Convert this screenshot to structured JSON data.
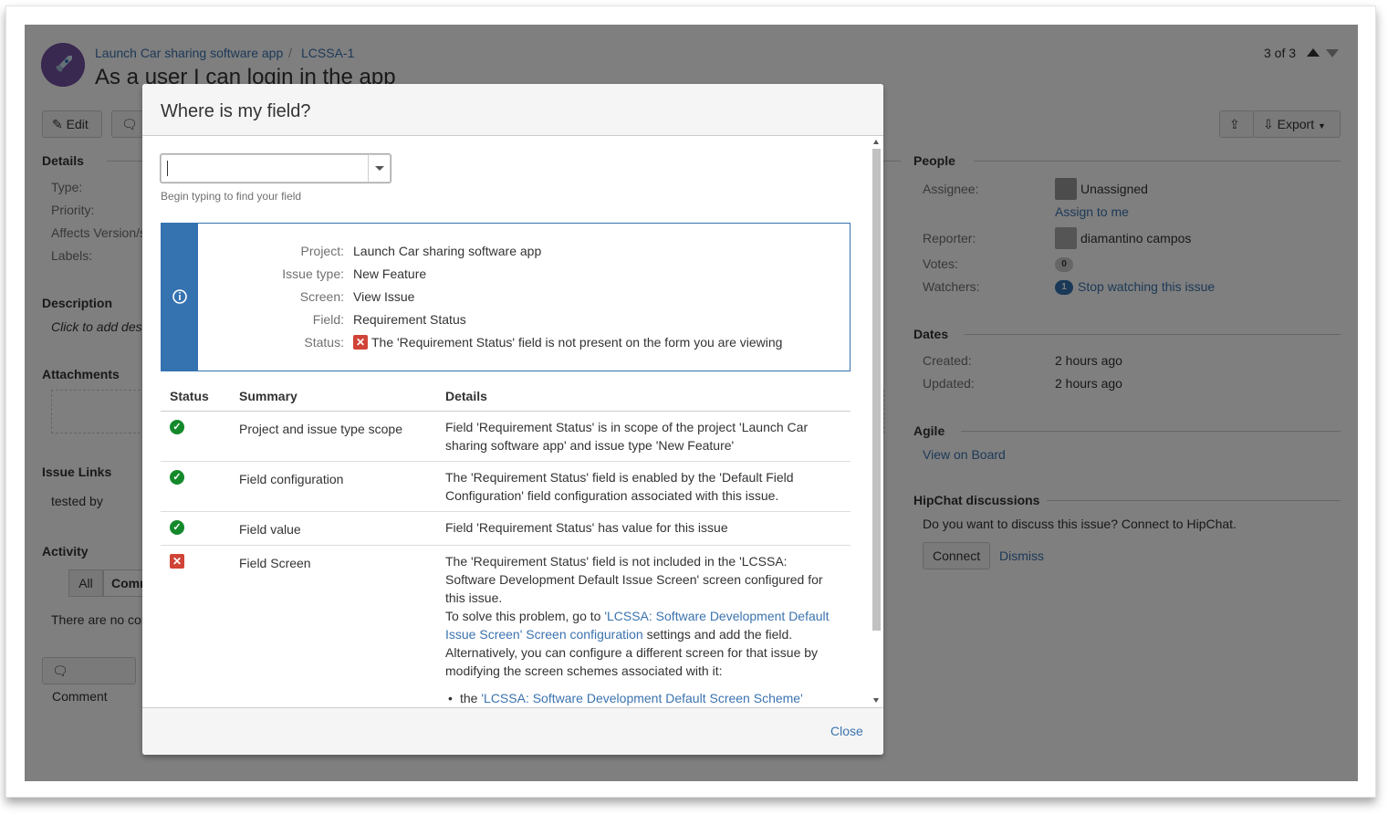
{
  "issue": {
    "breadcrumb_project": "Launch Car sharing software app",
    "breadcrumb_sep": "/",
    "breadcrumb_key": "LCSSA-1",
    "title": "As a user I can login in the app",
    "pager": "3 of 3"
  },
  "toolbar": {
    "edit_label": "Edit",
    "export_label": "Export"
  },
  "details": {
    "heading": "Details",
    "labels": [
      "Type:",
      "Priority:",
      "Affects Version/s:",
      "Labels:"
    ]
  },
  "description": {
    "heading": "Description",
    "placeholder": "Click to add description"
  },
  "attachments": {
    "heading": "Attachments"
  },
  "issue_links": {
    "heading": "Issue Links",
    "tested_by": "tested by"
  },
  "activity": {
    "heading": "Activity",
    "tab_all": "All",
    "tab_comments": "Comments",
    "empty": "There are no comments yet on this issue.",
    "comment_button": "Comment"
  },
  "people": {
    "heading": "People",
    "assignee_label": "Assignee:",
    "assignee_value": "Unassigned",
    "assign_to_me": "Assign to me",
    "reporter_label": "Reporter:",
    "reporter_value": "diamantino campos",
    "votes_label": "Votes:",
    "votes_count": "0",
    "watchers_label": "Watchers:",
    "watchers_count": "1",
    "watchers_link": "Stop watching this issue"
  },
  "dates": {
    "heading": "Dates",
    "created_label": "Created:",
    "created_value": "2 hours ago",
    "updated_label": "Updated:",
    "updated_value": "2 hours ago"
  },
  "agile": {
    "heading": "Agile",
    "link": "View on Board"
  },
  "hipchat": {
    "heading": "HipChat discussions",
    "text": "Do you want to discuss this issue? Connect to HipChat.",
    "connect": "Connect",
    "dismiss": "Dismiss"
  },
  "dialog": {
    "title": "Where is my field?",
    "search_hint": "Begin typing to find your field",
    "search_value": "",
    "info": {
      "project_label": "Project:",
      "project_value": "Launch Car sharing software app",
      "issue_type_label": "Issue type:",
      "issue_type_value": "New Feature",
      "screen_label": "Screen:",
      "screen_value": "View Issue",
      "field_label": "Field:",
      "field_value": "Requirement Status",
      "status_label": "Status:",
      "status_value": "The 'Requirement Status' field is not present on the form you are viewing"
    },
    "table": {
      "headers": [
        "Status",
        "Summary",
        "Details"
      ],
      "rows": [
        {
          "status": "ok",
          "summary": "Project and issue type scope",
          "details": "Field 'Requirement Status' is in scope of the project 'Launch Car sharing software app' and issue type 'New Feature'"
        },
        {
          "status": "ok",
          "summary": "Field configuration",
          "details": "The 'Requirement Status' field is enabled by the 'Default Field Configuration' field configuration associated with this issue."
        },
        {
          "status": "ok",
          "summary": "Field value",
          "details": "Field 'Requirement Status' has value for this issue"
        },
        {
          "status": "error",
          "summary": "Field Screen",
          "details_1": "The 'Requirement Status' field is not included in the 'LCSSA: Software Development Default Issue Screen' screen configured for this issue.",
          "details_2_prefix": "To solve this problem, go to ",
          "details_2_link": "'LCSSA: Software Development Default Issue Screen' Screen configuration",
          "details_2_suffix": " settings and add the field.",
          "details_3": "Alternatively, you can configure a different screen for that issue by modifying the screen schemes associated with it:",
          "bullet_prefix": "the ",
          "bullet_link": "'LCSSA: Software Development Default Screen Scheme'"
        }
      ]
    },
    "close_label": "Close"
  },
  "colors": {
    "link": "#3b73af",
    "info_blue": "#3572b0",
    "ok_green": "#14892c",
    "error_red": "#d04437"
  }
}
